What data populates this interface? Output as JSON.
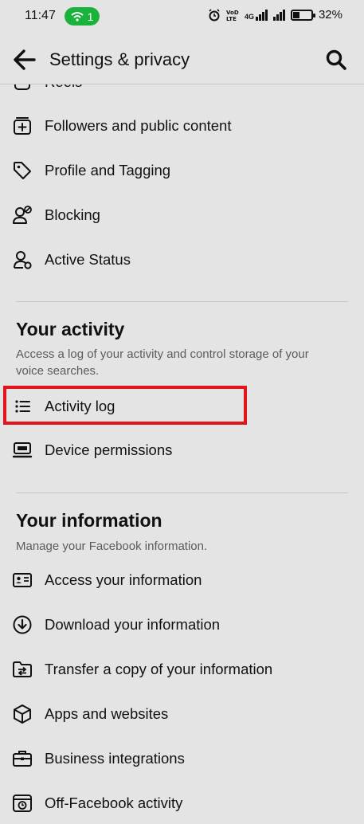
{
  "status_bar": {
    "time": "11:47",
    "hotspot_count": "1",
    "network_label": "4G",
    "battery_percent": "32%"
  },
  "header": {
    "title": "Settings & privacy"
  },
  "top_items": [
    {
      "label": "Reels",
      "icon": "reels-icon"
    },
    {
      "label": "Followers and public content",
      "icon": "add-square-icon"
    },
    {
      "label": "Profile and Tagging",
      "icon": "tag-icon"
    },
    {
      "label": "Blocking",
      "icon": "blocked-person-icon"
    },
    {
      "label": "Active Status",
      "icon": "person-status-icon"
    }
  ],
  "your_activity": {
    "title": "Your activity",
    "description": "Access a log of your activity and control storage of your voice searches.",
    "items": [
      {
        "label": "Activity log",
        "icon": "list-icon"
      },
      {
        "label": "Device permissions",
        "icon": "device-icon"
      }
    ]
  },
  "your_information": {
    "title": "Your information",
    "description": "Manage your Facebook information.",
    "items": [
      {
        "label": "Access your information",
        "icon": "id-card-icon"
      },
      {
        "label": "Download your information",
        "icon": "download-circle-icon"
      },
      {
        "label": "Transfer a copy of your information",
        "icon": "folder-transfer-icon"
      },
      {
        "label": "Apps and websites",
        "icon": "cube-icon"
      },
      {
        "label": "Business integrations",
        "icon": "briefcase-icon"
      },
      {
        "label": "Off-Facebook activity",
        "icon": "history-icon"
      }
    ]
  },
  "colors": {
    "background": "#e4e4e4",
    "highlight": "#e3141c",
    "hotspot": "#19b23a"
  }
}
